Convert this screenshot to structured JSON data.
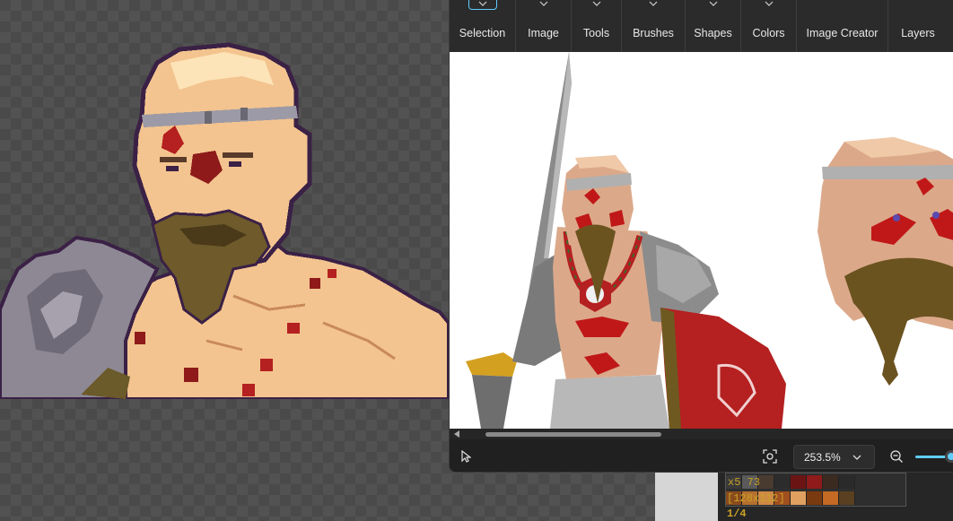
{
  "ribbon": {
    "groups": [
      {
        "label": "Selection"
      },
      {
        "label": "Image"
      },
      {
        "label": "Tools"
      },
      {
        "label": "Brushes"
      },
      {
        "label": "Shapes"
      },
      {
        "label": "Colors"
      },
      {
        "label": "Image Creator"
      },
      {
        "label": "Layers"
      }
    ]
  },
  "status_bar": {
    "zoom": "253.5%"
  },
  "palette": {
    "coords": "x5  73",
    "size": "[128x112]",
    "page": "1/4",
    "row1": [
      "#3a3a3a",
      "#5a5a5a",
      "#4a3b30",
      "#2c2c2c",
      "#6b1414",
      "#8e1a1a",
      "#3b2a20",
      "#2a2a2a"
    ],
    "row2": [
      "#8a4b1c",
      "#b5702e",
      "#cf8a44",
      "#a04f1e",
      "#e0a060",
      "#7a3a10",
      "#c46a24",
      "#5a4020"
    ]
  },
  "colors": {
    "accent": "#60cdff",
    "ribbon_bg": "#2b2b2b",
    "window_bg": "#202020",
    "palette_text": "#c9a227"
  }
}
